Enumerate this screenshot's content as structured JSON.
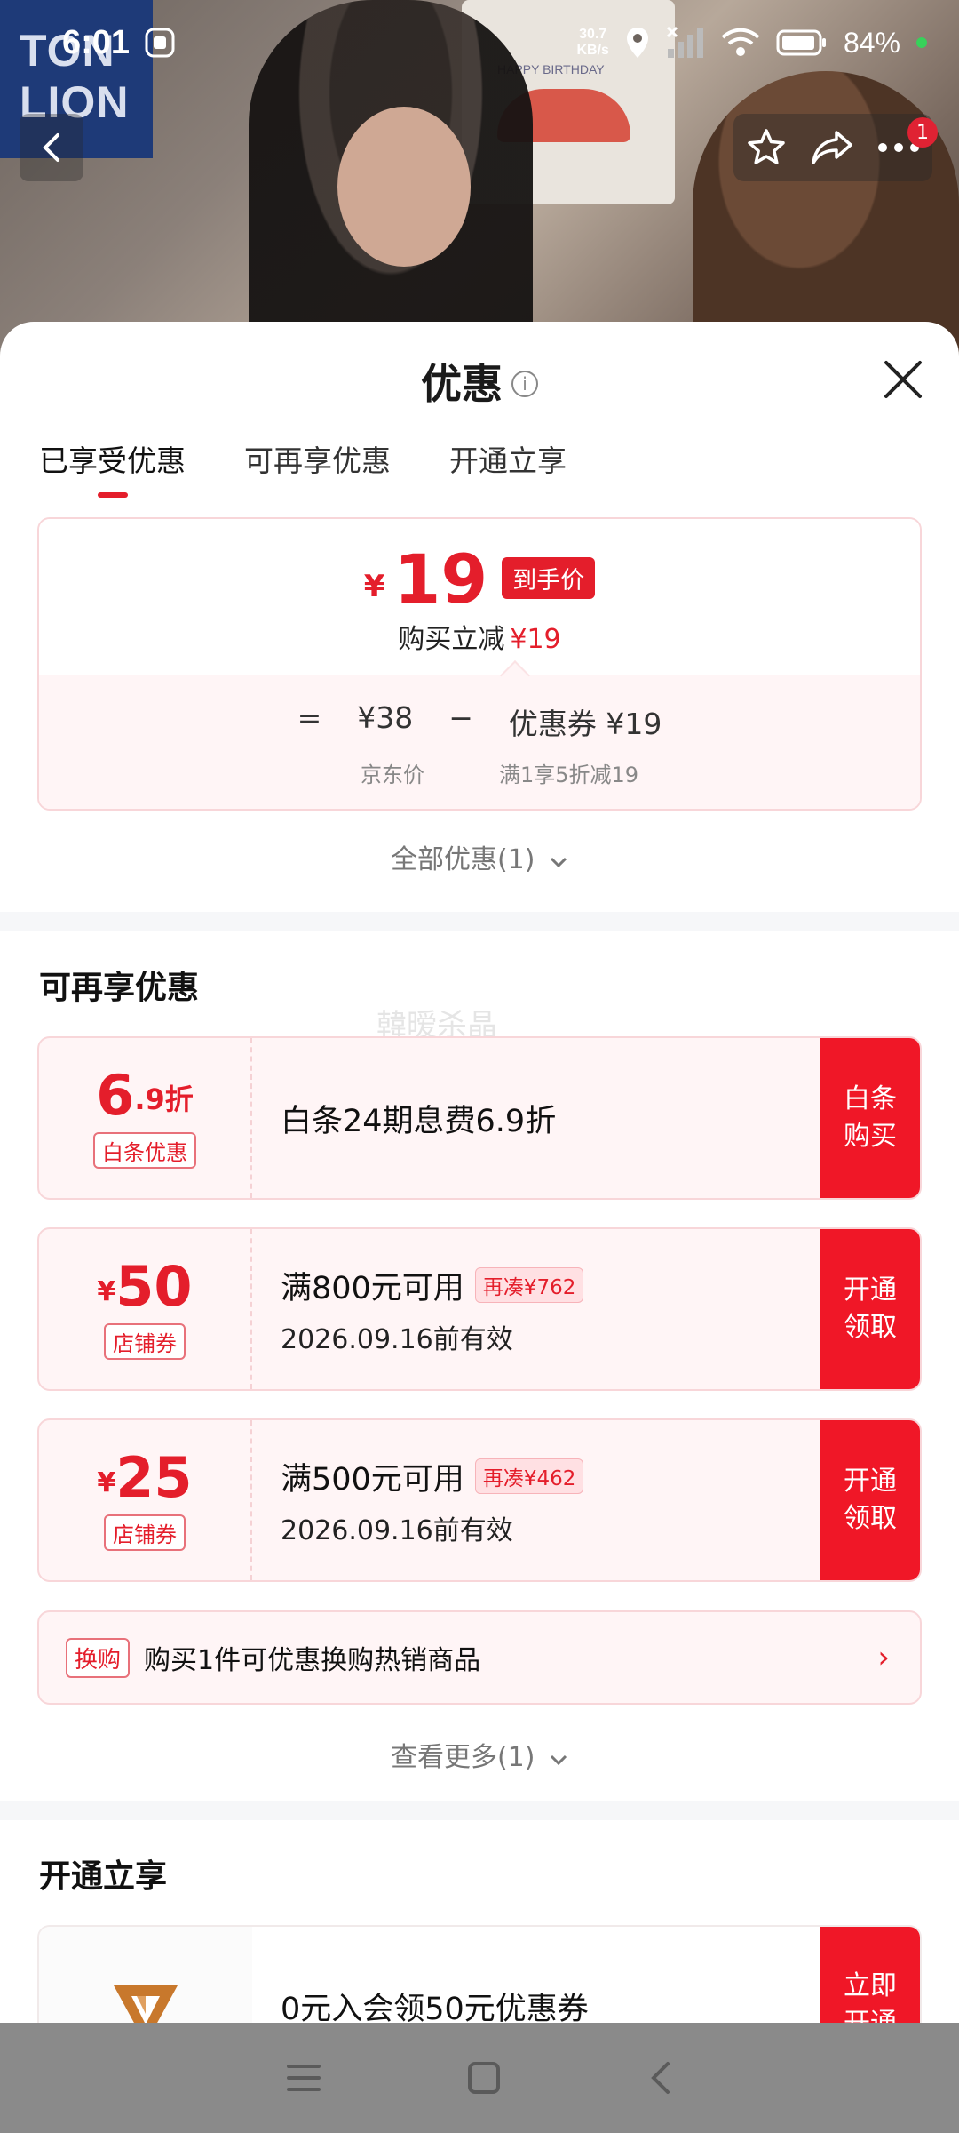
{
  "status_bar": {
    "time": "6:01",
    "net_speed_top": "30.7",
    "net_speed_unit": "KB/s",
    "battery": "84%"
  },
  "photo": {
    "logo_line1": "TON",
    "logo_line2": "LION",
    "board_text": "HAPPY BIRTHDAY",
    "notification_count": "1"
  },
  "sheet": {
    "title": "优惠",
    "info_glyph": "i",
    "tabs": [
      {
        "label": "已享受优惠",
        "active": true
      },
      {
        "label": "可再享优惠",
        "active": false
      },
      {
        "label": "开通立享",
        "active": false
      }
    ],
    "price_card": {
      "currency": "¥",
      "final_price": "19",
      "final_tag": "到手价",
      "reduce_label": "购买立减",
      "reduce_value": "¥19",
      "eq": "=",
      "jd_price": "¥38",
      "minus": "−",
      "coupon_label": "优惠券 ¥19",
      "jd_price_label": "京东价",
      "coupon_desc": "满1享5折减19"
    },
    "all_offers_link": "全部优惠(1)",
    "watermark": "韓暧杀晶"
  },
  "more_offers": {
    "title": "可再享优惠",
    "coupons": [
      {
        "amount_int": "6",
        "amount_dec": ".9折",
        "currency": "",
        "type_tag": "白条优惠",
        "main": "白条24期息费6.9折",
        "pill": "",
        "sub": "",
        "action_line1": "白条",
        "action_line2": "购买"
      },
      {
        "amount_int": "50",
        "amount_dec": "",
        "currency": "¥",
        "type_tag": "店铺券",
        "main": "满800元可用",
        "pill": "再凑¥762",
        "sub": "2026.09.16前有效",
        "action_line1": "开通",
        "action_line2": "领取"
      },
      {
        "amount_int": "25",
        "amount_dec": "",
        "currency": "¥",
        "type_tag": "店铺券",
        "main": "满500元可用",
        "pill": "再凑¥462",
        "sub": "2026.09.16前有效",
        "action_line1": "开通",
        "action_line2": "领取"
      }
    ],
    "swap": {
      "tag": "换购",
      "text": "购买1件可优惠换购热销商品",
      "arrow": "›"
    },
    "see_more": "查看更多(1)"
  },
  "open_now": {
    "title": "开通立享",
    "vip": {
      "text": "0元入会领50元优惠券",
      "action_line1": "立即",
      "action_line2": "开通"
    }
  },
  "colors": {
    "accent": "#e41e2b",
    "action_bg": "#f01727",
    "card_bg": "#fff5f6",
    "card_border": "#f8d6d9"
  }
}
